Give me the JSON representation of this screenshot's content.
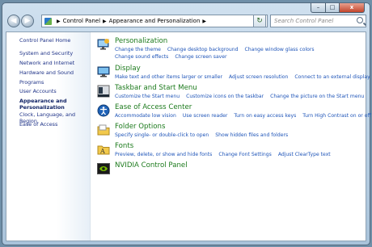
{
  "window": {
    "controls": {
      "minimize": "–",
      "maximize": "□",
      "close": "x"
    }
  },
  "navbar": {
    "breadcrumb": [
      "Control Panel",
      "Appearance and Personalization"
    ],
    "search_placeholder": "Search Control Panel"
  },
  "sidebar": {
    "items": [
      {
        "label": "Control Panel Home"
      },
      {
        "label": "System and Security"
      },
      {
        "label": "Network and Internet"
      },
      {
        "label": "Hardware and Sound"
      },
      {
        "label": "Programs"
      },
      {
        "label": "User Accounts"
      },
      {
        "label": "Appearance and Personalization",
        "current": true
      },
      {
        "label": "Clock, Language, and Region"
      },
      {
        "label": "Ease of Access"
      }
    ]
  },
  "categories": [
    {
      "title": "Personalization",
      "icon": "personalization-icon",
      "links": [
        "Change the theme",
        "Change desktop background",
        "Change window glass colors",
        "Change sound effects",
        "Change screen saver"
      ]
    },
    {
      "title": "Display",
      "icon": "display-icon",
      "links": [
        "Make text and other items larger or smaller",
        "Adjust screen resolution",
        "Connect to an external display"
      ]
    },
    {
      "title": "Taskbar and Start Menu",
      "icon": "taskbar-icon",
      "links": [
        "Customize the Start menu",
        "Customize icons on the taskbar",
        "Change the picture on the Start menu"
      ]
    },
    {
      "title": "Ease of Access Center",
      "icon": "ease-of-access-icon",
      "links": [
        "Accommodate low vision",
        "Use screen reader",
        "Turn on easy access keys",
        "Turn High Contrast on or off"
      ]
    },
    {
      "title": "Folder Options",
      "icon": "folder-options-icon",
      "links": [
        "Specify single- or double-click to open",
        "Show hidden files and folders"
      ]
    },
    {
      "title": "Fonts",
      "icon": "fonts-icon",
      "links": [
        "Preview, delete, or show and hide fonts",
        "Change Font Settings",
        "Adjust ClearType text"
      ]
    },
    {
      "title": "NVIDIA Control Panel",
      "icon": "nvidia-icon",
      "links": []
    }
  ]
}
